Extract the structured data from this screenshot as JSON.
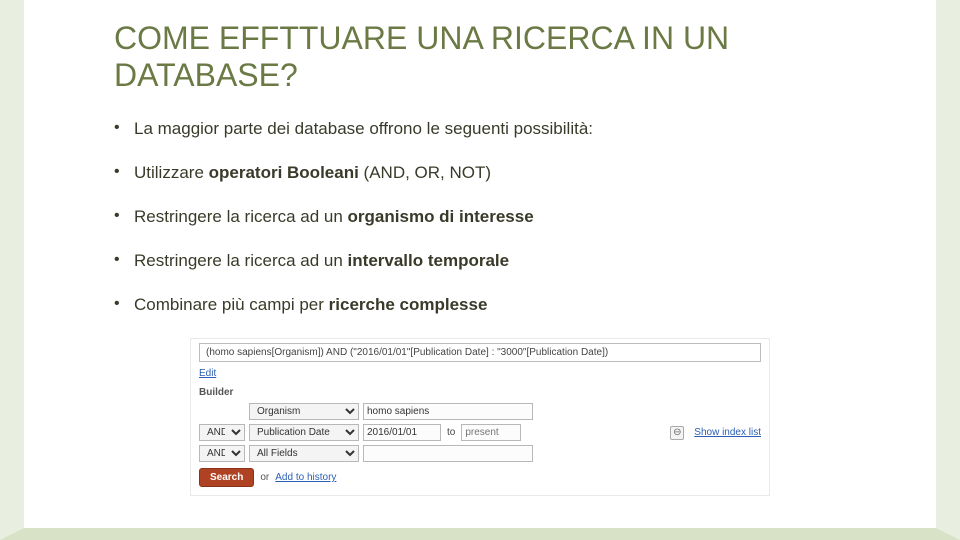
{
  "title": "COME EFFTTUARE UNA RICERCA IN UN DATABASE?",
  "bullets": {
    "b1": "La maggior parte dei database offrono le seguenti possibilità:",
    "b2a": "Utilizzare ",
    "b2b": "operatori Booleani",
    "b2c": " (AND, OR, NOT)",
    "b3a": "Restringere la ricerca ad un ",
    "b3b": "organismo di interesse",
    "b4a": "Restringere la ricerca ad un ",
    "b4b": "intervallo temporale",
    "b5a": "Combinare più campi per ",
    "b5b": "ricerche complesse"
  },
  "shot": {
    "query": "(homo sapiens[Organism]) AND (\"2016/01/01\"[Publication Date] : \"3000\"[Publication Date])",
    "edit": "Edit",
    "builder": "Builder",
    "row1": {
      "field": "Organism",
      "term": "homo sapiens"
    },
    "row2": {
      "op": "AND",
      "field": "Publication Date",
      "from": "2016/01/01",
      "to_lbl": "to",
      "to_placeholder": "present"
    },
    "row3": {
      "op": "AND",
      "field": "All Fields"
    },
    "minus": "⊖",
    "show_index": "Show index list",
    "search": "Search",
    "or": "or",
    "add_history": "Add to history"
  }
}
